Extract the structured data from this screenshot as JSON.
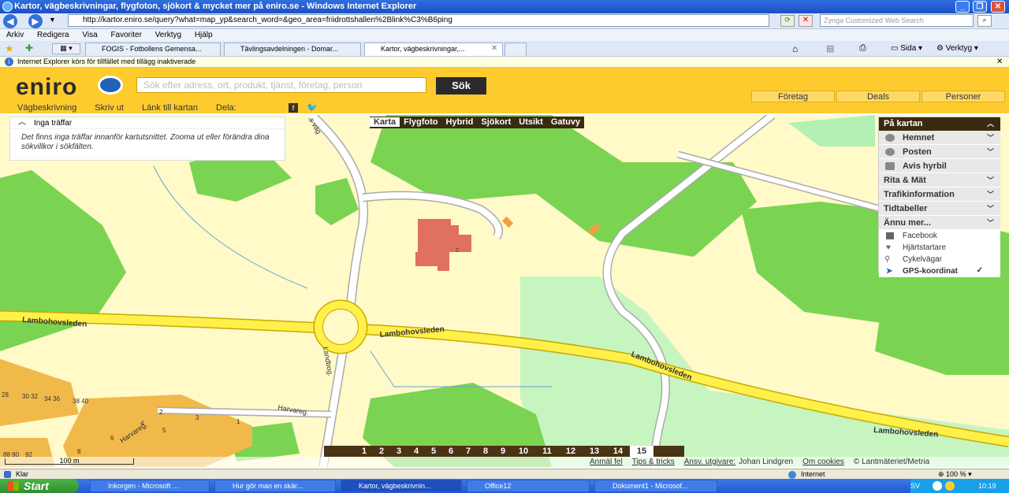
{
  "window": {
    "title": "Kartor, vägbeskrivningar, flygfoton, sjökort & mycket mer på eniro.se - Windows Internet Explorer"
  },
  "address": {
    "url": "http://kartor.eniro.se/query?what=map_yp&search_word=&geo_area=friidrottshallen%2Blink%C3%B6ping",
    "search_placeholder": "Zynga Customized Web Search"
  },
  "menu": [
    "Arkiv",
    "Redigera",
    "Visa",
    "Favoriter",
    "Verktyg",
    "Hjälp"
  ],
  "tabs": [
    "FOGIS - Fotbollens Gemensa...",
    "Tävlingsavdelningen - Domar...",
    "Kartor, vägbeskrivningar,..."
  ],
  "toolbar_right": {
    "sida": "Sida",
    "verktyg": "Verktyg"
  },
  "infobar": "Internet Explorer körs för tillfället med tillägg inaktiverade",
  "site": {
    "logo": "eniro",
    "search_placeholder": "Sök efter adress, ort, produkt, tjänst, företag, person",
    "search_button": "Sök",
    "header_tabs": [
      "Företag",
      "Deals",
      "Personer"
    ],
    "subnav": [
      "Vägbeskrivning",
      "Skriv ut",
      "Länk till kartan",
      "Dela:"
    ]
  },
  "map": {
    "types": [
      "Karta",
      "Flygfoto",
      "Hybrid",
      "Sjökort",
      "Utsikt",
      "Gatuvy"
    ],
    "no_results": {
      "title": "Inga träffar",
      "text": "Det finns inga träffar innanför kartutsnittet. Zooma ut eller förändra dina sökvillkor i sökfälten."
    },
    "labels": {
      "road1": "Lambohovsleden",
      "road2": "Lambohovsleden",
      "road3": "Lambohovsleden",
      "road4": "Lambohovsleden",
      "landbog": "Landbog.",
      "harvareg": "Harvareg.",
      "harvareg2": "Harvareg.",
      "vag": "s väg",
      "n1": "28",
      "n2": "30 32",
      "n3": "34 36",
      "n4": "38 40",
      "n5": "88 90",
      "n6": "92",
      "n7": "2",
      "n8": "4",
      "n9": "6",
      "n10": "8",
      "n11": "1",
      "n12": "3",
      "n13": "5",
      "n14": "2"
    },
    "zoom_levels": [
      "1",
      "2",
      "3",
      "4",
      "5",
      "6",
      "7",
      "8",
      "9",
      "10",
      "11",
      "12",
      "13",
      "14"
    ],
    "zoom_current": "15",
    "scale": "100 m",
    "footer_links": [
      "Anmäl fel",
      "Tips & tricks",
      "Ansv. utgivare:"
    ],
    "footer_text": {
      "publisher": "Johan Lindgren",
      "cookies": "Om cookies",
      "copyright": "© Lantmäteriet/Metria"
    }
  },
  "right_panel": {
    "header": "På kartan",
    "items": [
      "Hemnet",
      "Posten",
      "Avis hyrbil"
    ],
    "sections": [
      "Rita & Mät",
      "Trafikinformation",
      "Tidtabeller",
      "Ännu mer..."
    ],
    "more": [
      "Facebook",
      "Hjärtstartare",
      "Cykelvägar",
      "GPS-koordinat"
    ]
  },
  "status": {
    "left": "Klar",
    "zone": "Internet",
    "zoom": "100 %"
  },
  "taskbar": {
    "start": "Start",
    "items": [
      "Inkorgen - Microsoft ...",
      "Hur gör man en skär...",
      "Kartor, vägbeskrivnin...",
      "Office12",
      "Dokument1 - Microsof..."
    ],
    "lang": "SV",
    "clock": "10:19"
  }
}
